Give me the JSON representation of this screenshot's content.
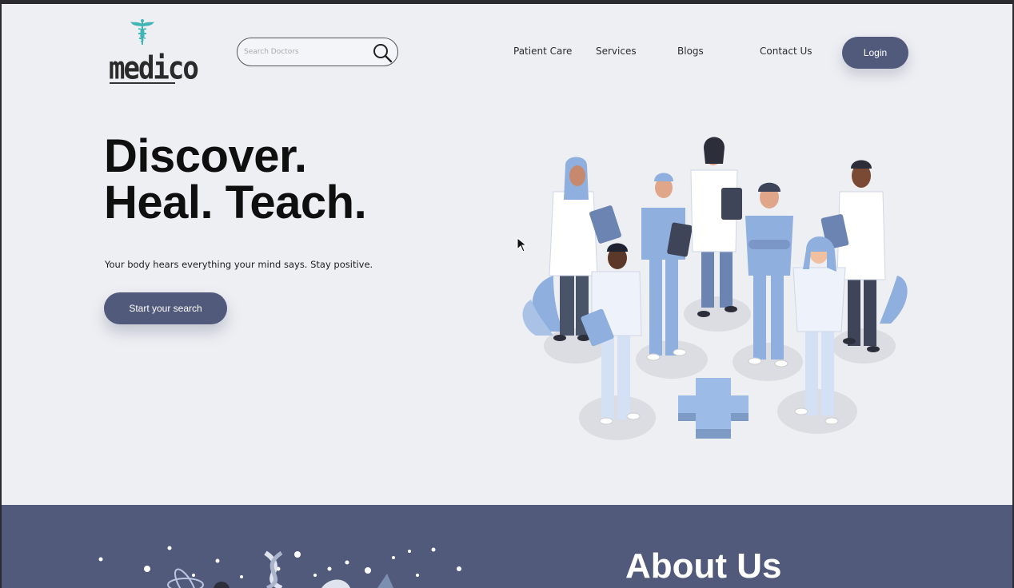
{
  "brand": {
    "name": "medico",
    "logo_icon": "caduceus-icon",
    "accent": "#3fb5b5"
  },
  "search": {
    "placeholder": "Search Doctors",
    "value": "",
    "icon": "search-icon"
  },
  "nav": {
    "items": [
      "Patient Care",
      "Services",
      "Blogs",
      "Contact Us"
    ],
    "login_label": "Login"
  },
  "hero": {
    "headline_line1": "Discover.",
    "headline_line2": "Heal. Teach.",
    "tagline": "Your body hears everything your mind says. Stay positive.",
    "cta_label": "Start your search"
  },
  "about": {
    "title": "About Us"
  },
  "colors": {
    "primary": "#525a7b",
    "background": "#eeeff3",
    "figure_blue": "#8fb0de",
    "figure_dark": "#4a5468"
  }
}
